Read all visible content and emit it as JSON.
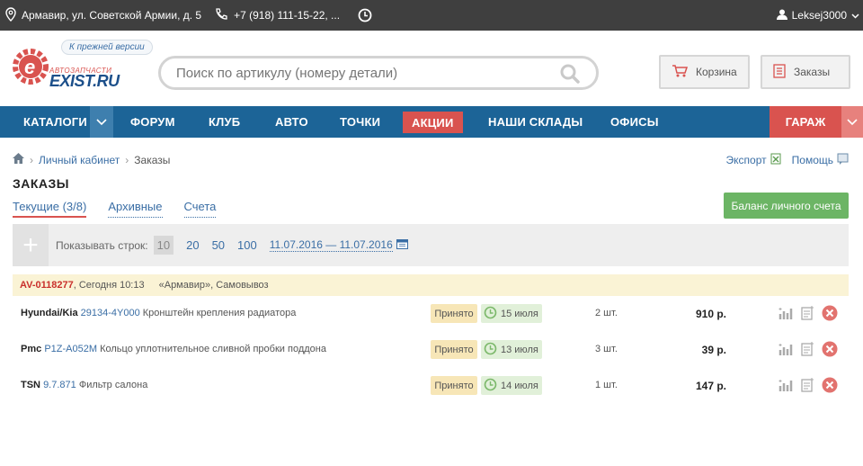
{
  "topbar": {
    "address": "Армавир, ул. Советской Армии, д. 5",
    "phone": "+7 (918) 111-15-22, ...",
    "user": "Leksej3000"
  },
  "header": {
    "logo_top": "АВТОЗАПЧАСТИ",
    "logo_main": "EXIST.RU",
    "prev_version": "К прежней версии",
    "search_placeholder": "Поиск по артикулу (номеру детали)",
    "cart_label": "Корзина",
    "orders_label": "Заказы"
  },
  "nav": {
    "items": [
      "КАТАЛОГИ",
      "ФОРУМ",
      "КЛУБ",
      "АВТО",
      "ТОЧКИ",
      "АКЦИИ",
      "НАШИ СКЛАДЫ",
      "ОФИСЫ"
    ],
    "garage": "ГАРАЖ"
  },
  "breadcrumb": {
    "home": "Личный кабинет",
    "current": "Заказы"
  },
  "tools": {
    "export": "Экспорт",
    "help": "Помощь"
  },
  "page": {
    "title": "ЗАКАЗЫ",
    "tabs": [
      "Текущие (3/8)",
      "Архивные",
      "Счета"
    ],
    "balance_button": "Баланс личного счета"
  },
  "filter": {
    "rows_label": "Показывать строк:",
    "rows_options": [
      "10",
      "20",
      "50",
      "100"
    ],
    "rows_selected": "10",
    "date_range": "11.07.2016 — 11.07.2016"
  },
  "order": {
    "number": "AV-0118277",
    "time": ", Сегодня 10:13",
    "delivery": "«Армавир», Самовывоз",
    "items": [
      {
        "brand": "Hyundai/Kia",
        "article": "29134-4Y000",
        "name": "Кронштейн крепления радиатора",
        "status": "Принято",
        "date": "15 июля",
        "qty": "2 шт.",
        "price": "910 р."
      },
      {
        "brand": "Pmc",
        "article": "P1Z-A052M",
        "name": "Кольцо уплотнительное сливной пробки поддона",
        "status": "Принято",
        "date": "13 июля",
        "qty": "3 шт.",
        "price": "39 р."
      },
      {
        "brand": "TSN",
        "article": "9.7.871",
        "name": "Фильтр салона",
        "status": "Принято",
        "date": "14 июля",
        "qty": "1 шт.",
        "price": "147 р."
      }
    ]
  },
  "colors": {
    "nav_blue": "#1c6497",
    "accent_red": "#d9534f",
    "balance_green": "#6cb565",
    "order_header": "#faf3d5",
    "status_bg": "#f7e6b7",
    "date_bg": "#e1f0d9"
  }
}
